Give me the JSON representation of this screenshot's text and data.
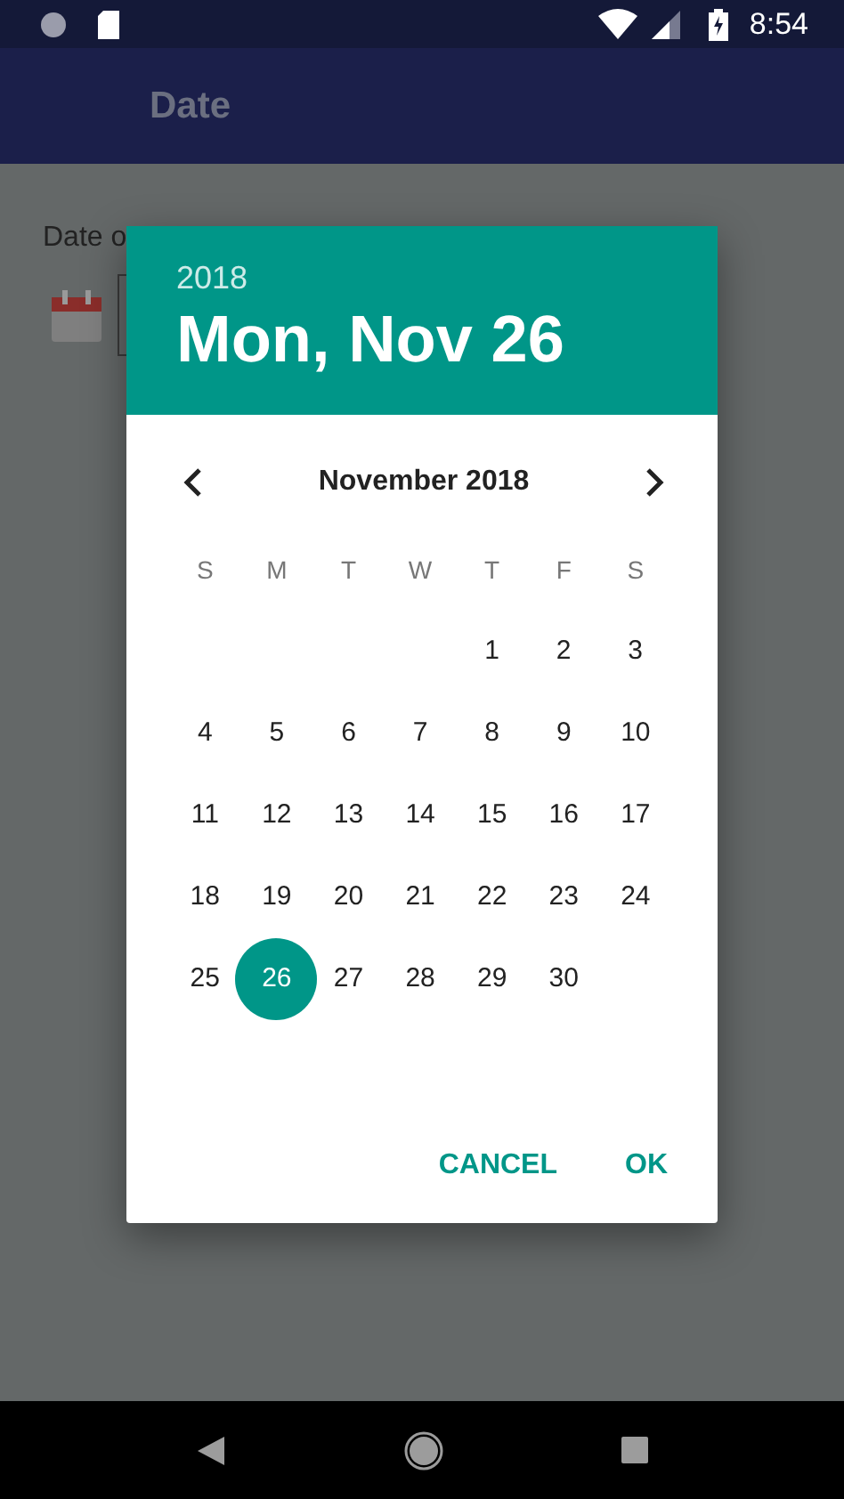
{
  "status_bar": {
    "time": "8:54"
  },
  "app_bar": {
    "title": "Date"
  },
  "form": {
    "label": "Date o"
  },
  "dialog": {
    "year": "2018",
    "date": "Mon, Nov 26",
    "month": "November 2018",
    "weekdays": [
      "S",
      "M",
      "T",
      "W",
      "T",
      "F",
      "S"
    ],
    "weeks": [
      {
        "kind": "leading",
        "days": [
          {
            "label": "1",
            "selected": false
          },
          {
            "label": "2",
            "selected": false
          },
          {
            "label": "3",
            "selected": false
          }
        ]
      },
      {
        "kind": "full",
        "days": [
          {
            "label": "4",
            "selected": false
          },
          {
            "label": "5",
            "selected": false
          },
          {
            "label": "6",
            "selected": false
          },
          {
            "label": "7",
            "selected": false
          },
          {
            "label": "8",
            "selected": false
          },
          {
            "label": "9",
            "selected": false
          },
          {
            "label": "10",
            "selected": false
          }
        ]
      },
      {
        "kind": "full",
        "days": [
          {
            "label": "11",
            "selected": false
          },
          {
            "label": "12",
            "selected": false
          },
          {
            "label": "13",
            "selected": false
          },
          {
            "label": "14",
            "selected": false
          },
          {
            "label": "15",
            "selected": false
          },
          {
            "label": "16",
            "selected": false
          },
          {
            "label": "17",
            "selected": false
          }
        ]
      },
      {
        "kind": "full",
        "days": [
          {
            "label": "18",
            "selected": false
          },
          {
            "label": "19",
            "selected": false
          },
          {
            "label": "20",
            "selected": false
          },
          {
            "label": "21",
            "selected": false
          },
          {
            "label": "22",
            "selected": false
          },
          {
            "label": "23",
            "selected": false
          },
          {
            "label": "24",
            "selected": false
          }
        ]
      },
      {
        "kind": "trailing",
        "days": [
          {
            "label": "25",
            "selected": false
          },
          {
            "label": "26",
            "selected": true
          },
          {
            "label": "27",
            "selected": false
          },
          {
            "label": "28",
            "selected": false
          },
          {
            "label": "29",
            "selected": false
          },
          {
            "label": "30",
            "selected": false
          }
        ]
      }
    ],
    "buttons": [
      "CANCEL",
      "OK"
    ]
  }
}
